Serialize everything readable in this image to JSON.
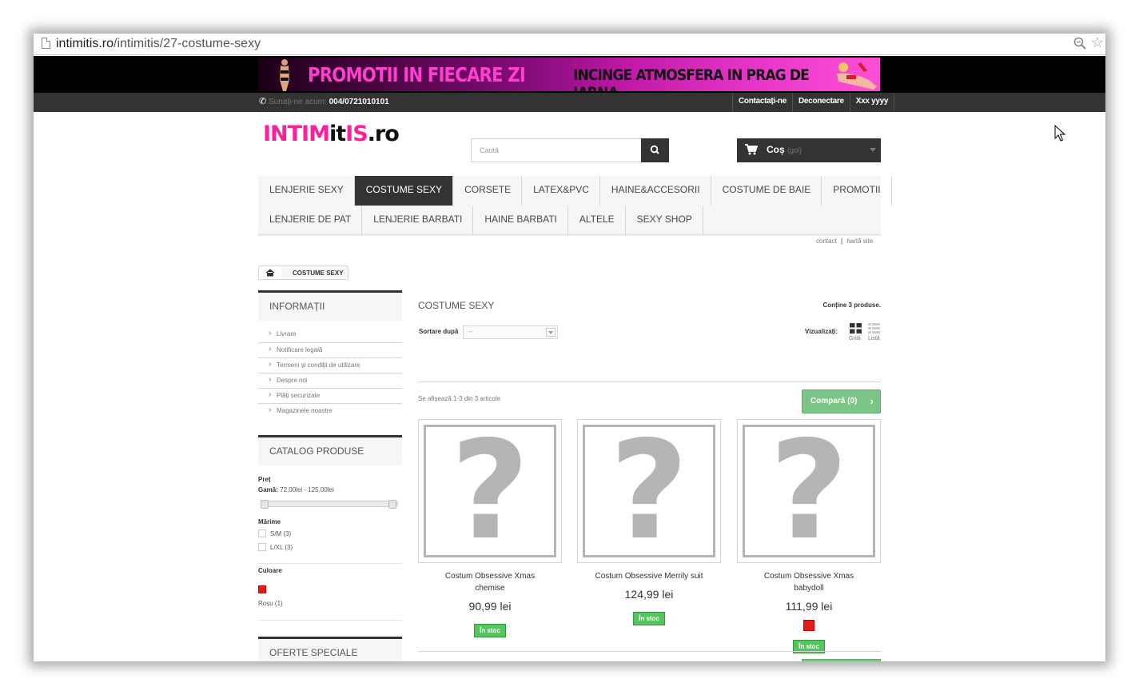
{
  "browser": {
    "url_domain": "intimitis.ro",
    "url_path": "/intimitis/27-costume-sexy"
  },
  "banner": {
    "text_left": "PROMOTII IN FIECARE ZI",
    "text_right": "INCINGE ATMOSFERA IN PRAG DE IARNA"
  },
  "topbar": {
    "call_label": "Sunați-ne acum:",
    "phone": "004/0721010101",
    "links": [
      "Contactați-ne",
      "Deconectare",
      "Xxx yyyy"
    ]
  },
  "logo": {
    "part1": "INTIM",
    "part2": "it",
    "part3": "IS",
    "part4": ".ro"
  },
  "search": {
    "placeholder": "Caută"
  },
  "cart": {
    "label": "Coș",
    "status": "(gol)"
  },
  "menu": {
    "row1": [
      "LENJERIE SEXY",
      "COSTUME SEXY",
      "CORSETE",
      "LATEX&PVC",
      "HAINE&ACCESORII",
      "COSTUME DE BAIE",
      "PROMOTII"
    ],
    "row2": [
      "LENJERIE DE PAT",
      "LENJERIE BARBATI",
      "HAINE BARBATI",
      "ALTELE",
      "SEXY SHOP"
    ],
    "active": "COSTUME SEXY"
  },
  "sublinks": {
    "contact": "contact",
    "separator": "|",
    "sitemap": "hartă site"
  },
  "breadcrumb": {
    "current": "COSTUME SEXY"
  },
  "sidebar": {
    "info_title": "INFORMAȚII",
    "info_links": [
      "Livrare",
      "Notificare legală",
      "Termeni și condiții de utilizare",
      "Despre noi",
      "Plăți securizate",
      "Magazinele noastre"
    ],
    "catalog_title": "CATALOG PRODUSE",
    "price_label": "Preț",
    "range_label": "Gamă:",
    "range_value": "72,00lei - 125,00lei",
    "price_min_fraction": 0.0,
    "price_max_fraction": 1.0,
    "size_label": "Mărime",
    "sizes": [
      "S/M (3)",
      "L/XL (3)"
    ],
    "color_label": "Culoare",
    "color_hex": "#e41b17",
    "color_name": "Roșu (1)",
    "offers_title": "OFERTE SPECIALE"
  },
  "category": {
    "title": "COSTUME SEXY",
    "count": "Conține 3 produse.",
    "sort_label": "Sortare după",
    "sort_value": "--",
    "view_label": "Vizualizați:",
    "view_grid": "Grilă",
    "view_list": "Listă",
    "showing": "Se afișează 1-3 din 3 articole",
    "compare": "Compară (0)"
  },
  "products": [
    {
      "name": "Costum Obsessive Xmas chemise",
      "price": "90,99 lei",
      "stock": "În stoc",
      "swatch": false
    },
    {
      "name": "Costum Obsessive Merrily suit",
      "price": "124,99 lei",
      "stock": "În stoc",
      "swatch": false
    },
    {
      "name": "Costum Obsessive Xmas babydoll",
      "price": "111,99 lei",
      "stock": "În stoc",
      "swatch": true
    }
  ],
  "colors": {
    "brand_pink": "#ff1f9e",
    "dark": "#333333",
    "green": "#55c65e",
    "compare_green": "#7dc488"
  }
}
